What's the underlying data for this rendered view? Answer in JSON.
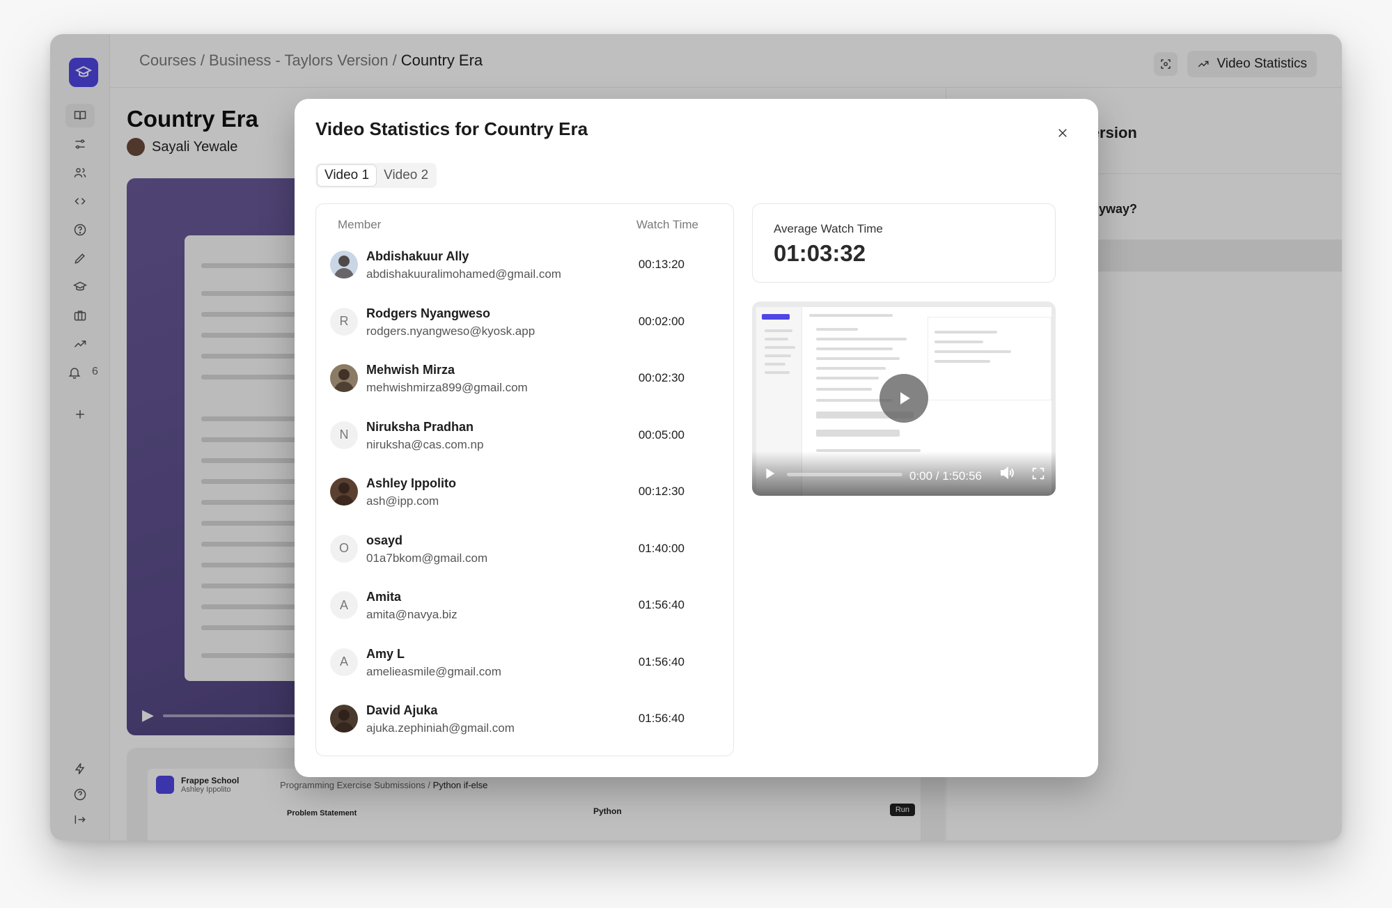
{
  "breadcrumb": {
    "items": [
      "Courses",
      "Business - Taylors Version"
    ],
    "current": "Country Era"
  },
  "topbar": {
    "stats_button": "Video Statistics"
  },
  "sidebar": {
    "notification_count": "6"
  },
  "lesson": {
    "title": "Country Era",
    "author": "Sayali Yewale"
  },
  "right_pane": {
    "heading": "s Version",
    "question": "ift anyway?"
  },
  "background_card": {
    "app_name": "Frappe School",
    "user": "Ashley Ippolito",
    "crumb_parent": "Programming Exercise Submissions",
    "crumb_current": "Python if-else",
    "section": "Problem Statement",
    "lang": "Python",
    "run": "Run"
  },
  "modal": {
    "title": "Video Statistics for Country Era",
    "tabs": [
      "Video 1",
      "Video 2"
    ],
    "active_tab": 0,
    "columns": {
      "member": "Member",
      "watch_time": "Watch Time"
    },
    "members": [
      {
        "name": "Abdishakuur Ally",
        "email": "abdishakuuralimohamed@gmail.com",
        "time": "00:13:20",
        "initial": "",
        "avatar_color": "#c8d6e6"
      },
      {
        "name": "Rodgers Nyangweso",
        "email": "rodgers.nyangweso@kyosk.app",
        "time": "00:02:00",
        "initial": "R",
        "avatar_color": ""
      },
      {
        "name": "Mehwish Mirza",
        "email": "mehwishmirza899@gmail.com",
        "time": "00:02:30",
        "initial": "",
        "avatar_color": "#8b7a64"
      },
      {
        "name": "Niruksha Pradhan",
        "email": "niruksha@cas.com.np",
        "time": "00:05:00",
        "initial": "N",
        "avatar_color": ""
      },
      {
        "name": "Ashley Ippolito",
        "email": "ash@ipp.com",
        "time": "00:12:30",
        "initial": "",
        "avatar_color": "#5a4030"
      },
      {
        "name": "osayd",
        "email": "01a7bkom@gmail.com",
        "time": "01:40:00",
        "initial": "O",
        "avatar_color": ""
      },
      {
        "name": "Amita",
        "email": "amita@navya.biz",
        "time": "01:56:40",
        "initial": "A",
        "avatar_color": ""
      },
      {
        "name": "Amy L",
        "email": "amelieasmile@gmail.com",
        "time": "01:56:40",
        "initial": "A",
        "avatar_color": ""
      },
      {
        "name": "David Ajuka",
        "email": "ajuka.zephiniah@gmail.com",
        "time": "01:56:40",
        "initial": "",
        "avatar_color": "#4a3a2e"
      }
    ],
    "average": {
      "label": "Average Watch Time",
      "value": "01:03:32"
    },
    "player": {
      "time": "0:00 / 1:50:56"
    }
  },
  "colors": {
    "brand": "#4f46e5",
    "overlay": "rgba(0,0,0,0.25)"
  },
  "icons": [
    "logo-icon",
    "book-icon",
    "sliders-icon",
    "users-icon",
    "code-icon",
    "help-icon",
    "pencil-icon",
    "graduation-icon",
    "briefcase-icon",
    "trend-icon",
    "bell-icon",
    "plus-icon",
    "bolt-icon",
    "logout-icon",
    "scan-icon",
    "close-icon",
    "play-icon",
    "volume-icon",
    "fullscreen-icon"
  ]
}
